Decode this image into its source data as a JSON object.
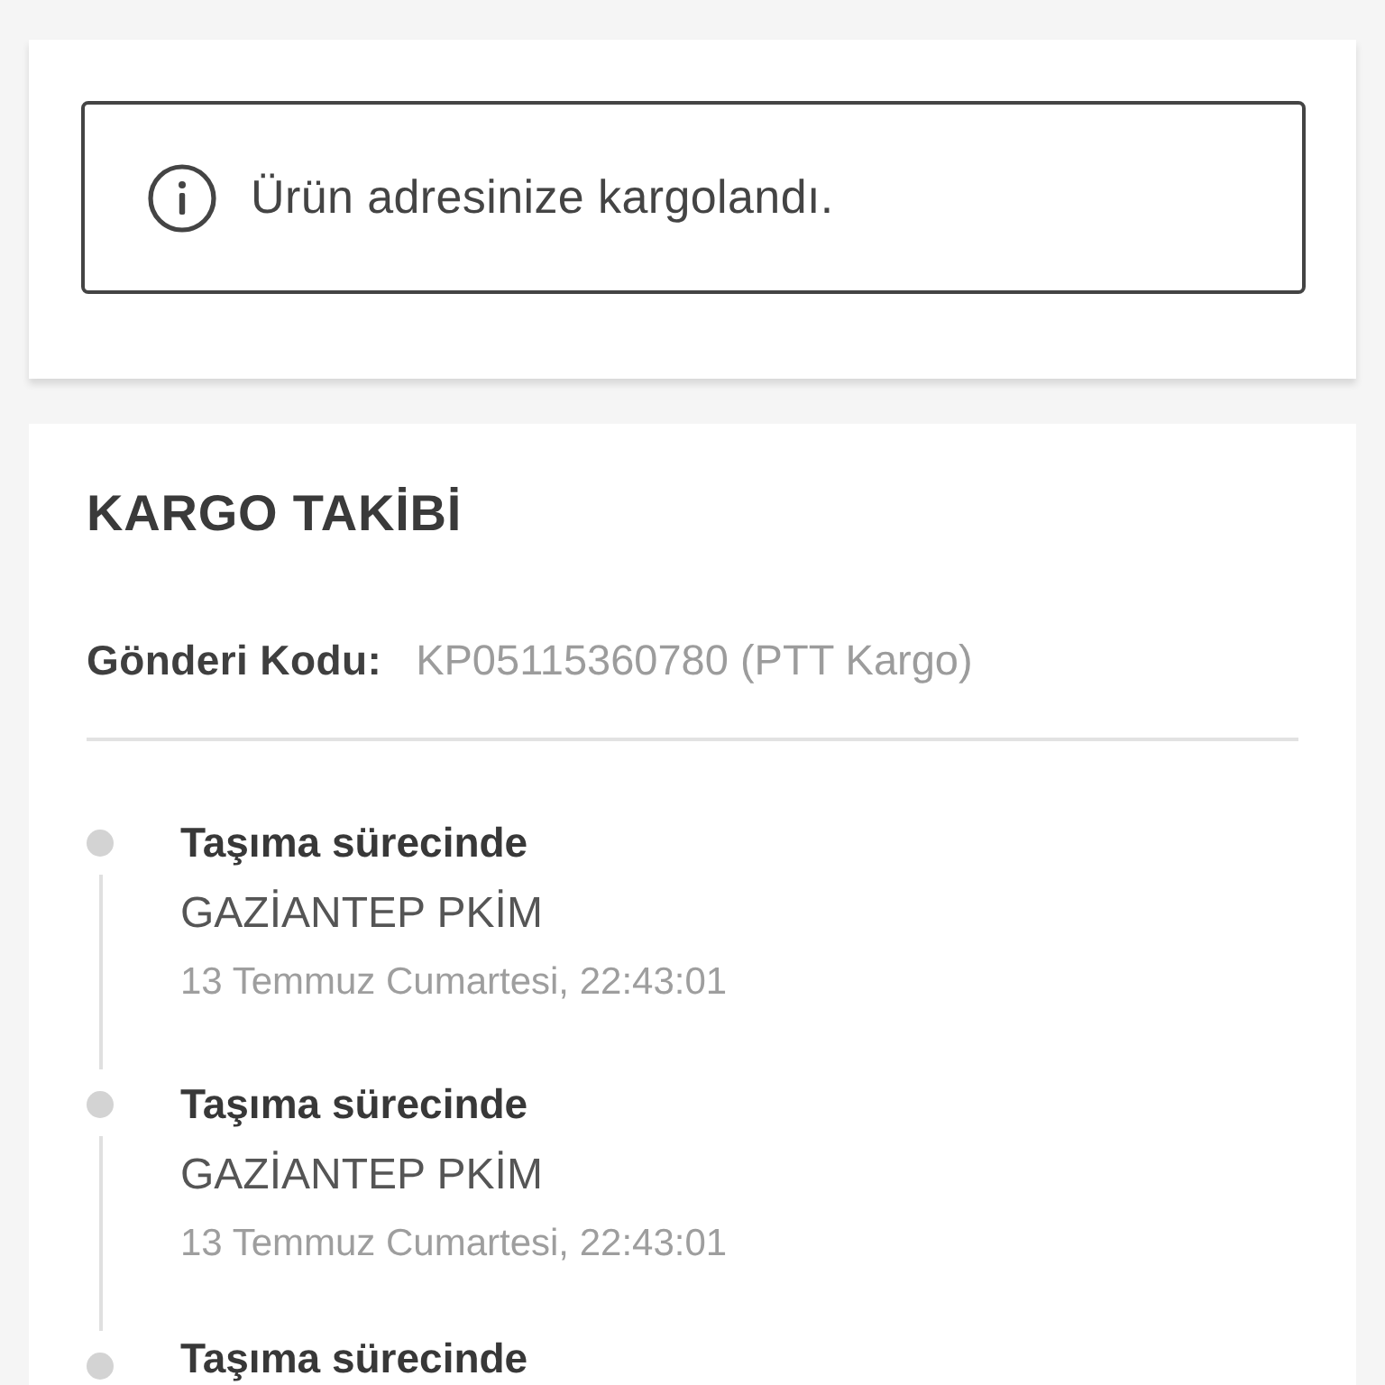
{
  "alert": {
    "text": "Ürün adresinize kargolandı."
  },
  "tracking": {
    "title": "KARGO TAKİBİ",
    "shipment_code": {
      "label": "Gönderi Kodu:",
      "value": "KP05115360780 (PTT Kargo)"
    },
    "events": [
      {
        "status": "Taşıma sürecinde",
        "location": "GAZİANTEP PKİM",
        "time": "13 Temmuz Cumartesi, 22:43:01"
      },
      {
        "status": "Taşıma sürecinde",
        "location": "GAZİANTEP PKİM",
        "time": "13 Temmuz Cumartesi, 22:43:01"
      },
      {
        "status": "Taşıma sürecinde"
      }
    ]
  }
}
